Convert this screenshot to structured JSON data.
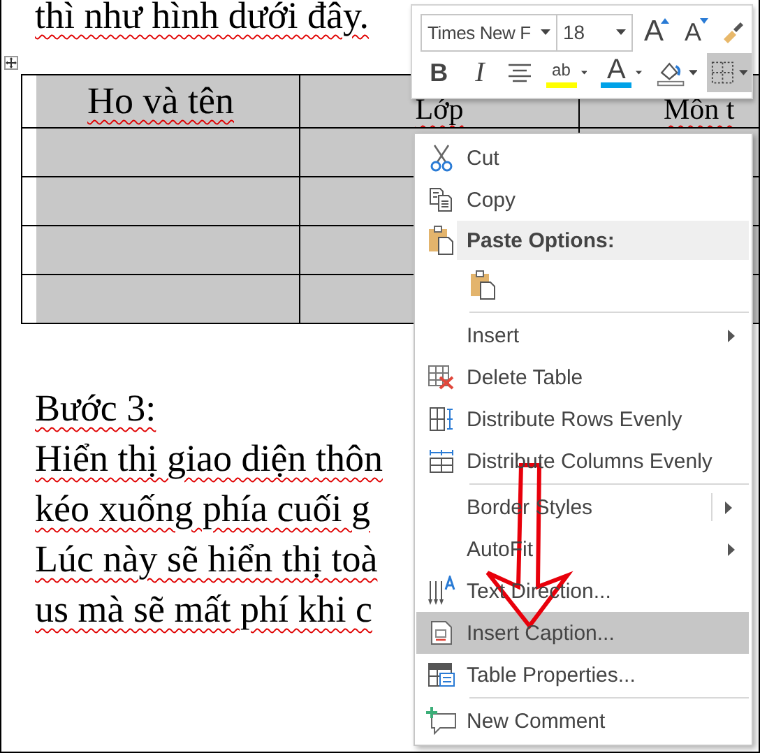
{
  "document": {
    "intro_line": "thì như hình dưới đây.",
    "table": {
      "headers": [
        "Ho và tên",
        "Lớp",
        "Môn t"
      ]
    },
    "paragraphs": [
      "Bước 3:",
      "Hiển thị giao diện thôn",
      "kéo xuống phía cuối g",
      "Lúc này sẽ hiển thị toà",
      "us mà sẽ mất phí khi c"
    ]
  },
  "mini_toolbar": {
    "font_name": "Times New F",
    "font_size": "18",
    "row_1_buttons": [
      {
        "kind": "grow-font",
        "glyph": "A",
        "dropdown": false,
        "selected": false
      },
      {
        "kind": "shrink-font",
        "glyph": "A",
        "dropdown": false,
        "selected": false
      },
      {
        "kind": "format-painter",
        "dropdown": false,
        "selected": false
      }
    ],
    "row_2_buttons": [
      {
        "kind": "bold",
        "glyph": "B",
        "dropdown": false,
        "selected": false
      },
      {
        "kind": "italic",
        "glyph": "I",
        "dropdown": false,
        "selected": false
      },
      {
        "kind": "center",
        "dropdown": false,
        "selected": false
      },
      {
        "kind": "highlight",
        "glyph": "ab",
        "color": "#ffff00",
        "dropdown": true,
        "selected": false
      },
      {
        "kind": "font-color",
        "glyph": "A",
        "color": "#00a2e8",
        "dropdown": true,
        "selected": false
      },
      {
        "kind": "shading",
        "dropdown": true,
        "selected": false
      },
      {
        "kind": "borders",
        "dropdown": true,
        "selected": true
      }
    ]
  },
  "context_menu": {
    "items": [
      {
        "kind": "command",
        "label": "Cut",
        "has_submenu": false,
        "selected": false
      },
      {
        "kind": "command",
        "label": "Copy",
        "has_submenu": false,
        "selected": false
      },
      {
        "kind": "header",
        "label": "Paste Options:"
      },
      {
        "kind": "paste-choices"
      },
      {
        "kind": "separator"
      },
      {
        "kind": "command",
        "label": "Insert",
        "has_submenu": true,
        "selected": false
      },
      {
        "kind": "command",
        "label": "Delete Table",
        "has_submenu": false,
        "selected": false
      },
      {
        "kind": "command",
        "label": "Distribute Rows Evenly",
        "has_submenu": false,
        "selected": false
      },
      {
        "kind": "command",
        "label": "Distribute Columns Evenly",
        "has_submenu": false,
        "selected": false
      },
      {
        "kind": "separator"
      },
      {
        "kind": "split-command",
        "label": "Border Styles",
        "has_submenu": true,
        "selected": false
      },
      {
        "kind": "command",
        "label": "AutoFit",
        "has_submenu": true,
        "selected": false
      },
      {
        "kind": "command",
        "label": "Text Direction...",
        "has_submenu": false,
        "selected": false
      },
      {
        "kind": "command",
        "label": "Insert Caption...",
        "has_submenu": false,
        "selected": true
      },
      {
        "kind": "command",
        "label": "Table Properties...",
        "has_submenu": false,
        "selected": false
      },
      {
        "kind": "separator"
      },
      {
        "kind": "command",
        "label": "New Comment",
        "has_submenu": false,
        "selected": false
      }
    ]
  }
}
